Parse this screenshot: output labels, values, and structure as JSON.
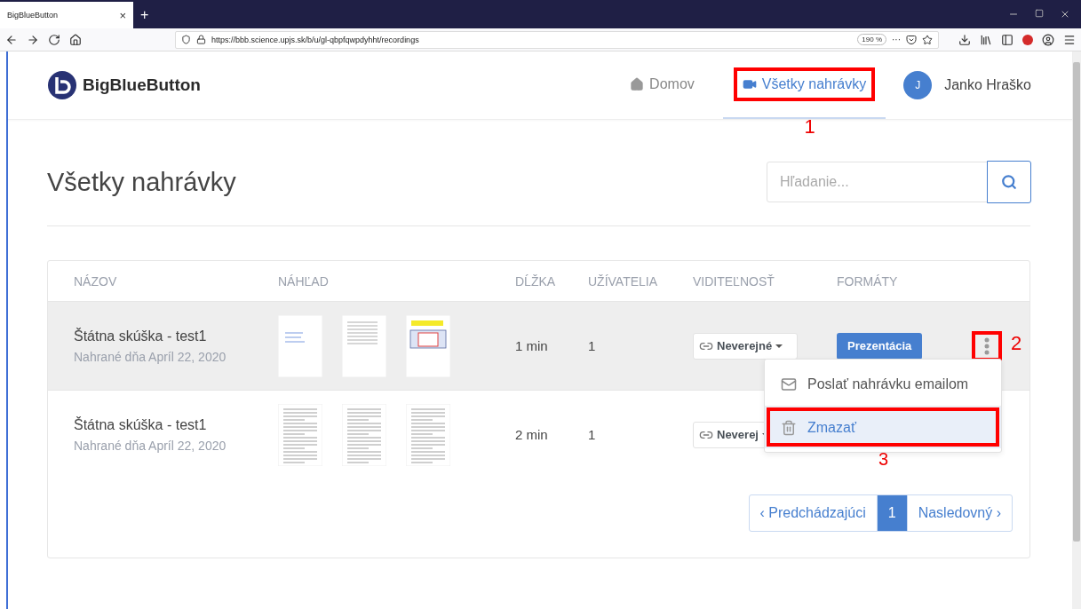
{
  "browser": {
    "tab_title": "BigBlueButton",
    "tab_close": "×",
    "new_tab": "+",
    "url": "https://bbb.science.upjs.sk/b/u/gl-qbpfqwpdyhht/recordings",
    "zoom": "190 %",
    "more": "···"
  },
  "header": {
    "logo": "BigBlueButton",
    "nav": [
      {
        "kind": "home",
        "label": "Domov",
        "selected": false,
        "marked": false
      },
      {
        "kind": "recordings",
        "label": "Všetky nahrávky",
        "selected": true,
        "marked": true,
        "callout": "1"
      }
    ],
    "user": {
      "initial": "J",
      "name": "Janko Hraško"
    }
  },
  "title": "Všetky nahrávky",
  "search": {
    "placeholder": "Hľadanie..."
  },
  "table": {
    "columns": [
      "NÁZOV",
      "NÁHĽAD",
      "DĹŽKA",
      "UŽÍVATELIA",
      "VIDITEĽNOSŤ",
      "FORMÁTY"
    ],
    "rows": [
      {
        "name": "Štátna skúška - test1",
        "date": "Nahrané dňa Apríl 22, 2020",
        "previews": [
          {
            "kind": "title"
          },
          {
            "kind": "list"
          },
          {
            "kind": "screenshot"
          }
        ],
        "length": "1 min",
        "users": "1",
        "visibility": "Neverejné",
        "format": "Prezentácia",
        "selected": true,
        "menu_marked": true,
        "callout": "2"
      },
      {
        "name": "Štátna skúška - test1",
        "date": "Nahrané dňa Apríl 22, 2020",
        "previews": [
          {
            "kind": "text"
          },
          {
            "kind": "text"
          },
          {
            "kind": "text"
          }
        ],
        "length": "2 min",
        "users": "1",
        "visibility": "Neverej",
        "selected": false
      }
    ]
  },
  "menu": {
    "items": [
      {
        "kind": "mail",
        "label": "Poslať nahrávku emailom",
        "selected": false,
        "marked": false
      },
      {
        "kind": "trash",
        "label": "Zmazať",
        "selected": true,
        "marked": true,
        "callout": "3"
      }
    ]
  },
  "pagination": [
    {
      "label": "‹ Predchádzajúci",
      "selected": false
    },
    {
      "label": "1",
      "selected": true
    },
    {
      "label": "Nasledovný ›",
      "selected": false
    }
  ]
}
